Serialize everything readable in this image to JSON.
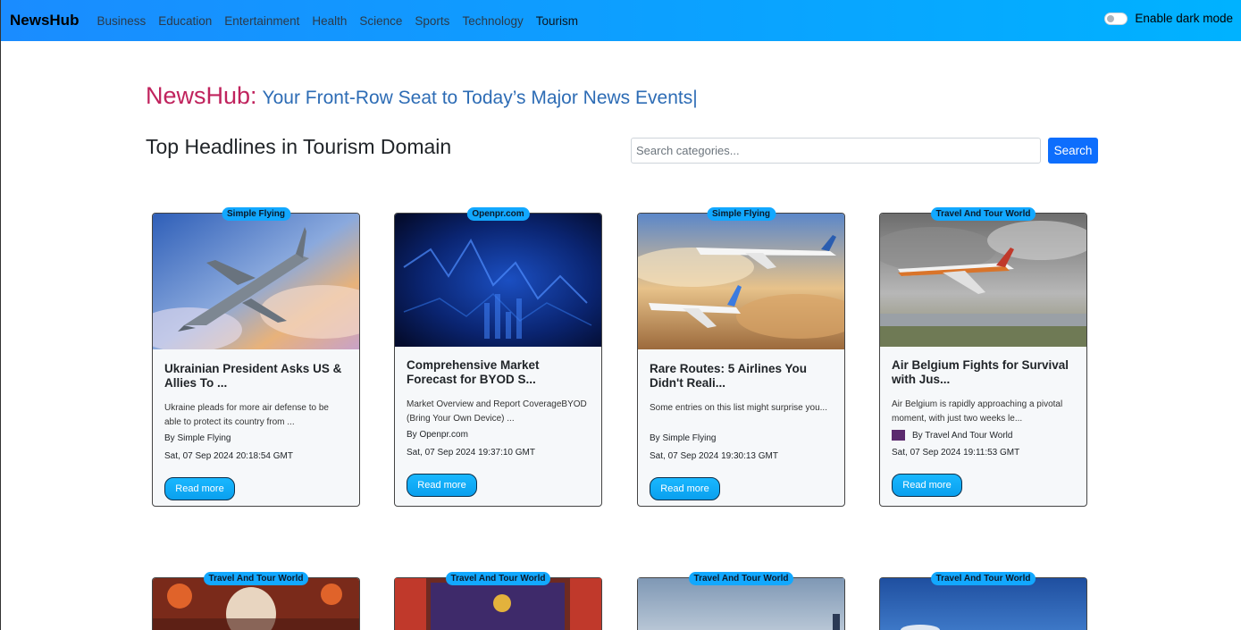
{
  "navbar": {
    "brand": "NewsHub",
    "links": [
      "Business",
      "Education",
      "Entertainment",
      "Health",
      "Science",
      "Sports",
      "Technology",
      "Tourism"
    ],
    "dark_mode_label": "Enable dark mode"
  },
  "hero": {
    "brand": "NewsHub:",
    "tagline": "Your Front-Row Seat to Today’s Major News Events",
    "caret": "|"
  },
  "section_title": "Top Headlines in Tourism Domain",
  "search": {
    "placeholder": "Search categories...",
    "button_label": "Search"
  },
  "read_more_label": "Read more",
  "cards": [
    {
      "source": "Simple Flying",
      "title": "Ukrainian President Asks US & Allies To ...",
      "description": "Ukraine pleads for more air defense to be able to protect its country from ...",
      "by": "By Simple Flying",
      "date": "Sat, 07 Sep 2024 20:18:54 GMT"
    },
    {
      "source": "Openpr.com",
      "title": "Comprehensive Market Forecast for BYOD S...",
      "description": "Market Overview and Report CoverageBYOD (Bring Your Own Device) ...",
      "by": "By Openpr.com",
      "date": "Sat, 07 Sep 2024 19:37:10 GMT"
    },
    {
      "source": "Simple Flying",
      "title": "Rare Routes: 5 Airlines You Didn't Reali...",
      "description": "Some entries on this list might surprise you...",
      "by": "By Simple Flying",
      "date": "Sat, 07 Sep 2024 19:30:13 GMT"
    },
    {
      "source": "Travel And Tour World",
      "title": "Air Belgium Fights for Survival with Jus...",
      "description": "Air Belgium is rapidly approaching a pivotal moment, with just two weeks le...",
      "by": "By Travel And Tour World",
      "date": "Sat, 07 Sep 2024 19:11:53 GMT"
    }
  ],
  "second_row_sources": [
    "Travel And Tour World",
    "Travel And Tour World",
    "Travel And Tour World",
    "Travel And Tour World"
  ]
}
